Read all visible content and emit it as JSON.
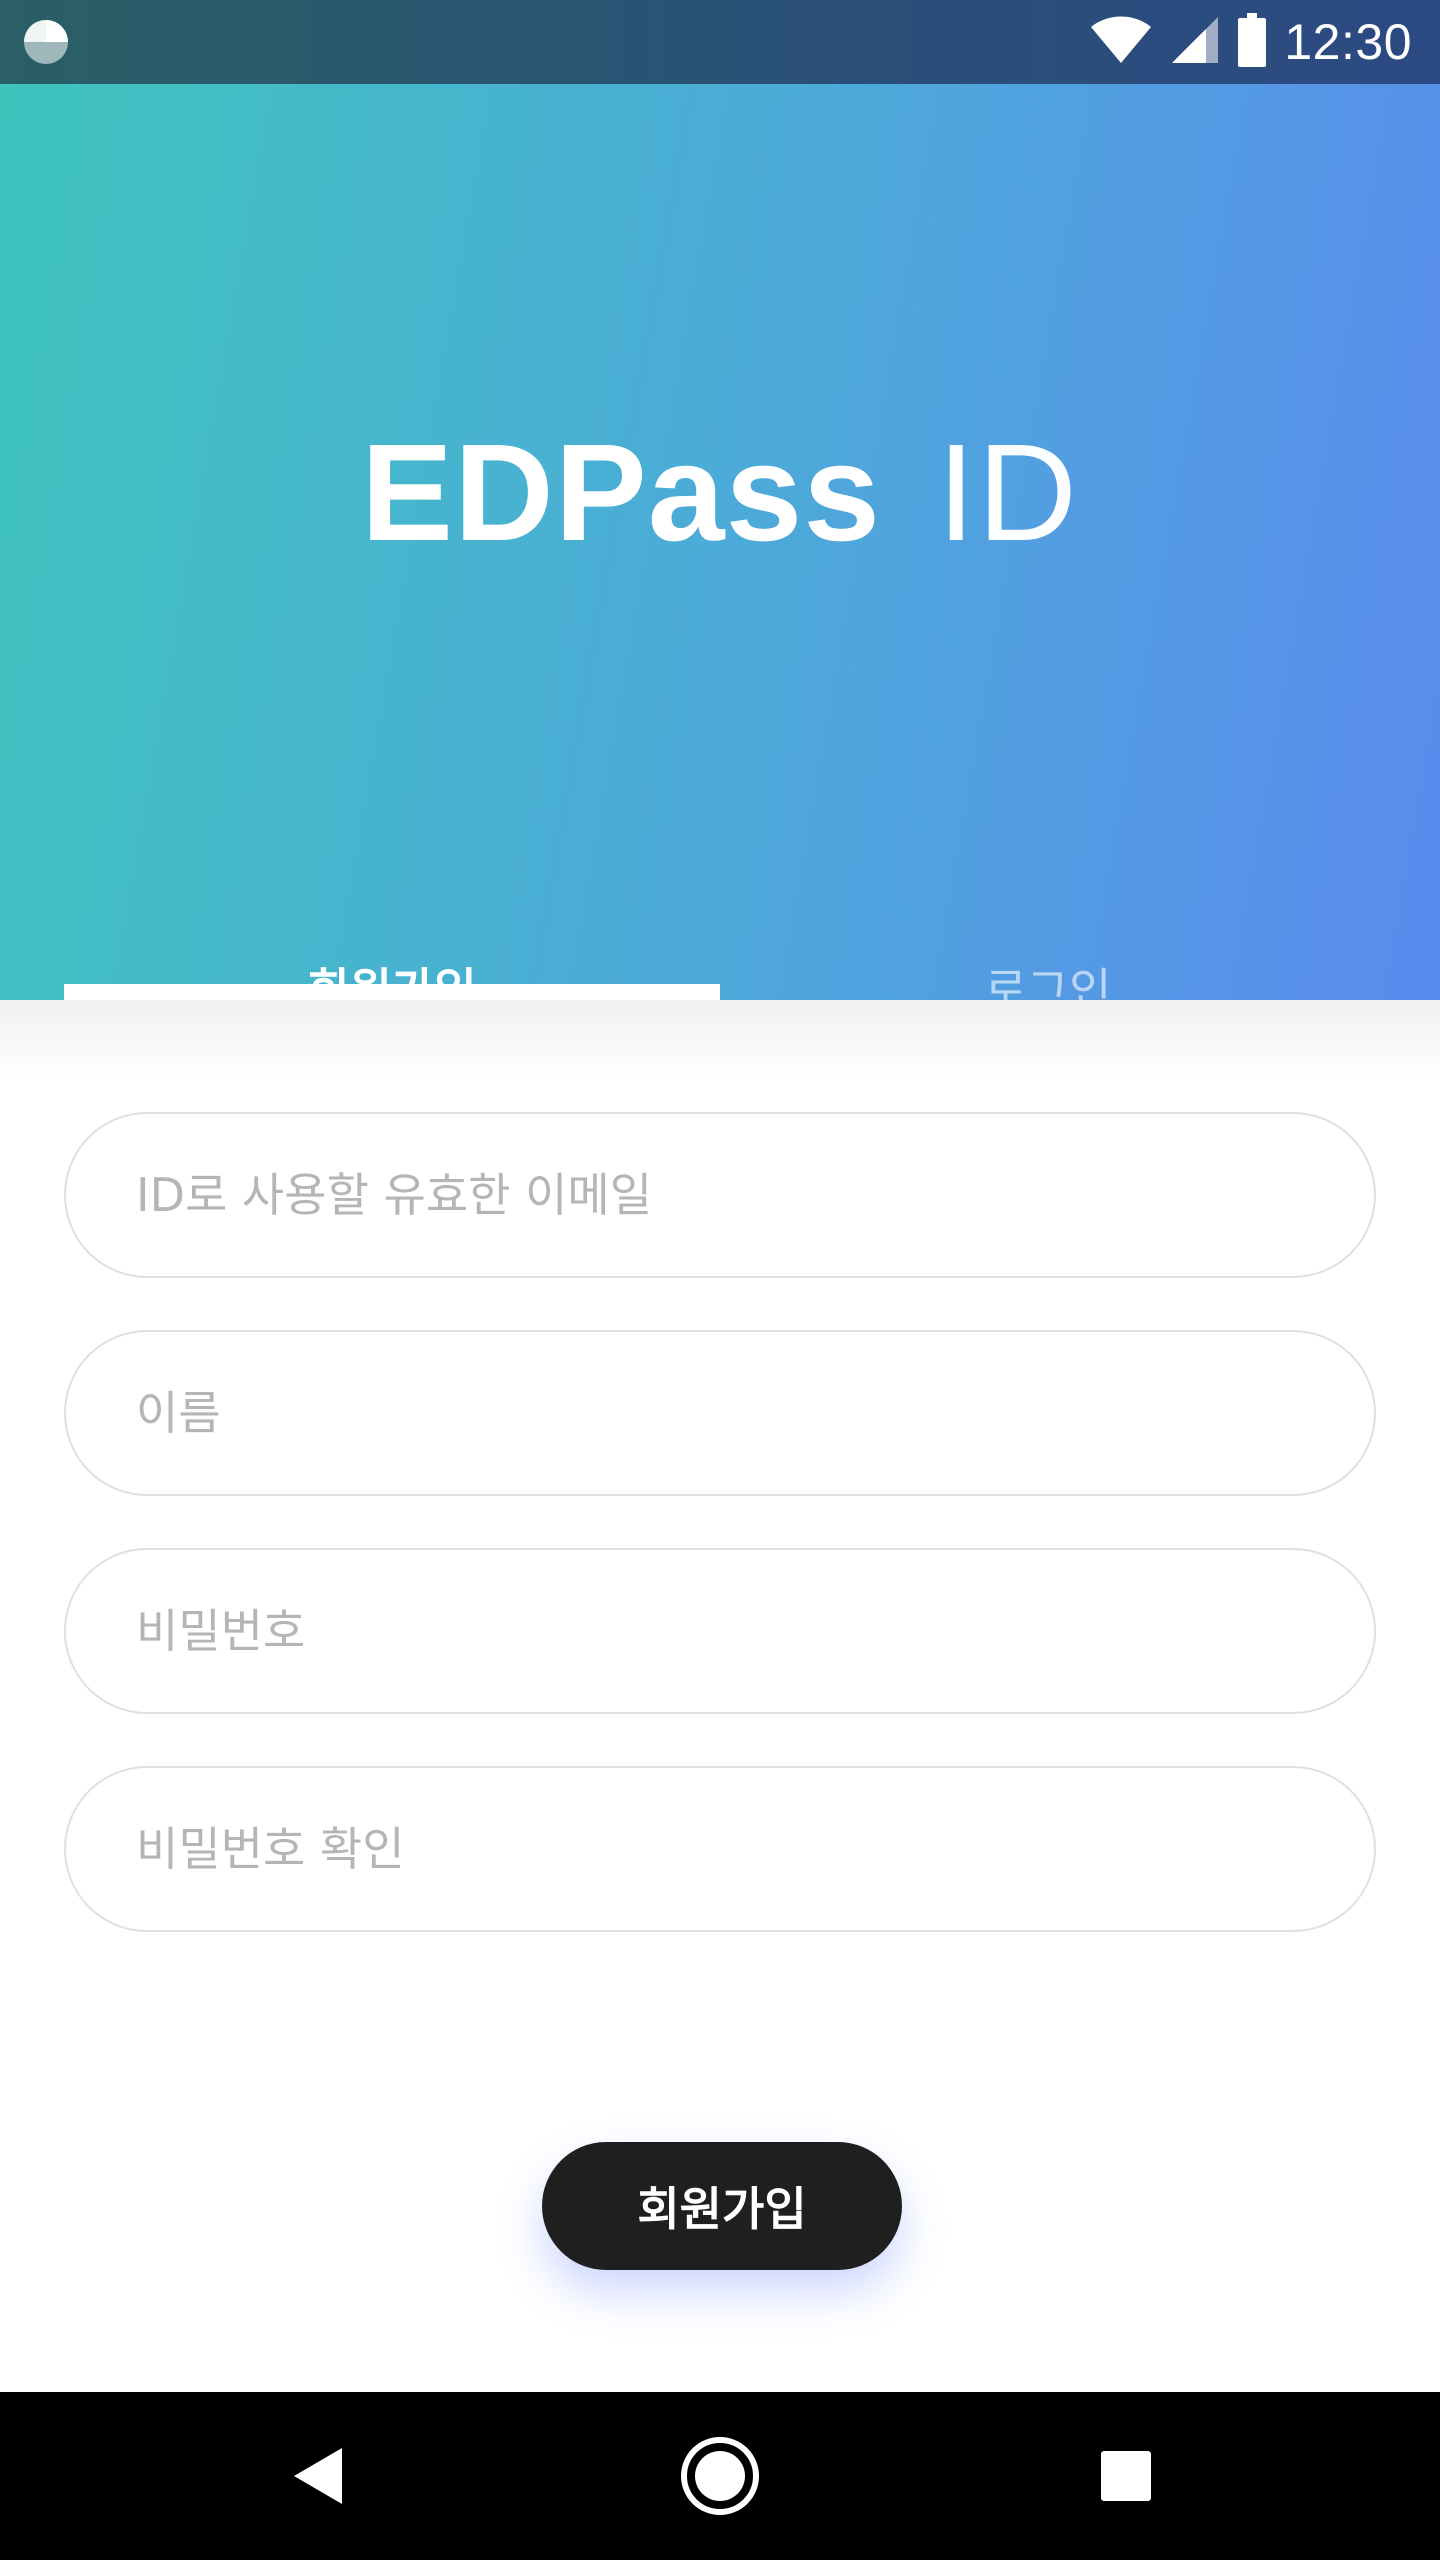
{
  "status_bar": {
    "time": "12:30"
  },
  "header": {
    "logo_primary": "EDPass",
    "logo_secondary": "ID",
    "tabs": [
      {
        "label": "회원가입",
        "active": true
      },
      {
        "label": "로그인",
        "active": false
      }
    ]
  },
  "form": {
    "email_placeholder": "ID로 사용할 유효한 이메일",
    "name_placeholder": "이름",
    "password_placeholder": "비밀번호",
    "password_confirm_placeholder": "비밀번호 확인",
    "submit_label": "회원가입"
  },
  "icons": {
    "app_indicator": "pie-app-icon",
    "wifi": "wifi-icon",
    "signal": "signal-icon",
    "battery": "battery-icon",
    "back": "back-triangle-icon",
    "home": "home-circle-icon",
    "recent": "recent-square-icon"
  },
  "colors": {
    "gradient_start": "#3ec4bd",
    "gradient_end": "#5a8bee",
    "button_bg": "#1f1f1f"
  }
}
